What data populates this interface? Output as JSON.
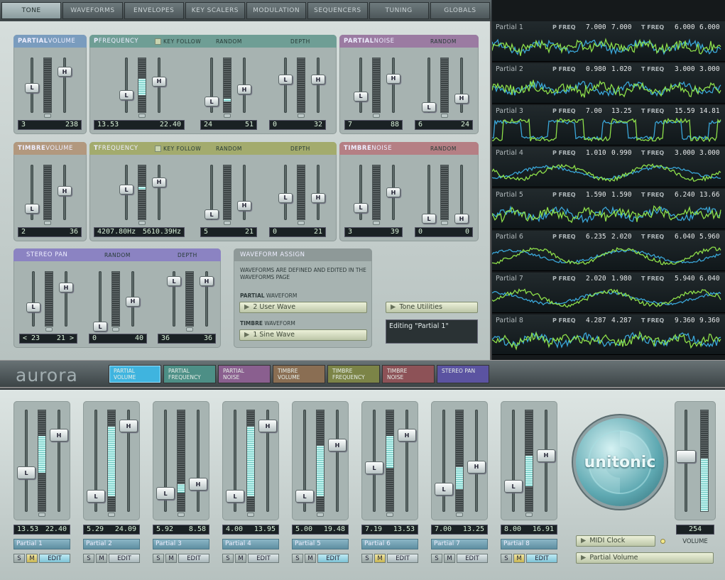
{
  "tabs": [
    "TONE",
    "WAVEFORMS",
    "ENVELOPES",
    "KEY SCALERS",
    "MODULATION",
    "SEQUENCERS",
    "TUNING",
    "GLOBALS"
  ],
  "active_tab": "TONE",
  "panels": {
    "partial_volume": {
      "bold": "PARTIAL",
      "rest": " VOLUME",
      "lo": "3",
      "hi": "238",
      "fill": 0.45
    },
    "p_frequency": {
      "bold": "P",
      "rest": " FREQUENCY",
      "key_follow": "KEY FOLLOW",
      "random": "RANDOM",
      "depth": "DEPTH",
      "lo": "13.53",
      "hi": "22.40",
      "rlo": "24",
      "rhi": "51",
      "dlo": "0",
      "dhi": "32"
    },
    "partial_noise": {
      "bold": "PARTIAL",
      "rest": " NOISE",
      "random": "RANDOM",
      "lo": "7",
      "hi": "88",
      "rlo": "6",
      "rhi": "24"
    },
    "timbre_volume": {
      "bold": "TIMBRE",
      "rest": " VOLUME",
      "lo": "2",
      "hi": "36"
    },
    "t_frequency": {
      "bold": "T",
      "rest": " FREQUENCY",
      "key_follow": "KEY FOLLOW",
      "random": "RANDOM",
      "depth": "DEPTH",
      "lo": "4207.80Hz",
      "hi": "5610.39Hz",
      "rlo": "5",
      "rhi": "21",
      "dlo": "0",
      "dhi": "21"
    },
    "timbre_noise": {
      "bold": "TIMBRE",
      "rest": " NOISE",
      "random": "RANDOM",
      "lo": "3",
      "hi": "39",
      "rlo": "0",
      "rhi": "0"
    },
    "stereo_pan": {
      "title": "STEREO PAN",
      "random": "RANDOM",
      "depth": "DEPTH",
      "lo": "< 23",
      "hi": "21 >",
      "rlo": "0",
      "rhi": "40",
      "dlo": "36",
      "dhi": "36"
    },
    "waveform_assign": {
      "title": "WAVEFORM ASSIGN",
      "note": "WAVEFORMS ARE DEFINED AND EDITED IN THE WAVEFORMS PAGE",
      "pw_bold": "PARTIAL",
      "pw_rest": " WAVEFORM",
      "pw_value": "2  User Wave",
      "tw_bold": "TIMBRE",
      "tw_rest": " WAVEFORM",
      "tw_value": "1  Sine Wave"
    }
  },
  "tone_utilities": "Tone Utilities",
  "editing": "Editing \"Partial 1\"",
  "scope": [
    {
      "name": "Partial 1",
      "pf1": "7.000",
      "pf2": "7.000",
      "tf1": "6.000",
      "tf2": "6.000"
    },
    {
      "name": "Partial 2",
      "pf1": "0.980",
      "pf2": "1.020",
      "tf1": "3.000",
      "tf2": "3.000"
    },
    {
      "name": "Partial 3",
      "pf1": "7.00",
      "pf2": "13.25",
      "tf1": "15.59",
      "tf2": "14.81"
    },
    {
      "name": "Partial 4",
      "pf1": "1.010",
      "pf2": "0.990",
      "tf1": "3.000",
      "tf2": "3.000"
    },
    {
      "name": "Partial 5",
      "pf1": "1.590",
      "pf2": "1.590",
      "tf1": "6.240",
      "tf2": "13.66"
    },
    {
      "name": "Partial 6",
      "pf1": "6.235",
      "pf2": "2.020",
      "tf1": "6.040",
      "tf2": "5.960"
    },
    {
      "name": "Partial 7",
      "pf1": "2.020",
      "pf2": "1.980",
      "tf1": "5.940",
      "tf2": "6.040"
    },
    {
      "name": "Partial 8",
      "pf1": "4.287",
      "pf2": "4.287",
      "tf1": "9.360",
      "tf2": "9.360"
    }
  ],
  "scope_labels": {
    "p": "P FREQ",
    "t": "T FREQ"
  },
  "logo": "aurora",
  "view_tabs": [
    {
      "l1": "PARTIAL",
      "l2": "VOLUME",
      "color": "#3fb4df"
    },
    {
      "l1": "PARTIAL",
      "l2": "FREQUENCY",
      "color": "#4d8f86"
    },
    {
      "l1": "PARTIAL",
      "l2": "NOISE",
      "color": "#8a5f8f"
    },
    {
      "l1": "TIMBRE",
      "l2": "VOLUME",
      "color": "#8a6e53"
    },
    {
      "l1": "TIMBRE",
      "l2": "FREQUENCY",
      "color": "#7c8447"
    },
    {
      "l1": "TIMBRE",
      "l2": "NOISE",
      "color": "#8d5257"
    },
    {
      "l1": "STEREO PAN",
      "l2": "",
      "color": "#5b53a1"
    }
  ],
  "partials": [
    {
      "lo": "13.53",
      "hi": "22.40",
      "name": "Partial 1",
      "m": true,
      "edit": true,
      "fill": [
        0.38,
        0.75
      ]
    },
    {
      "lo": "5.29",
      "hi": "24.09",
      "name": "Partial 2",
      "m": false,
      "edit": false,
      "fill": [
        0.15,
        0.84
      ]
    },
    {
      "lo": "5.92",
      "hi": "8.58",
      "name": "Partial 3",
      "m": false,
      "edit": false,
      "fill": [
        0.18,
        0.27
      ]
    },
    {
      "lo": "4.00",
      "hi": "13.95",
      "name": "Partial 4",
      "m": false,
      "edit": false,
      "fill": [
        0.15,
        0.84
      ]
    },
    {
      "lo": "5.00",
      "hi": "19.48",
      "name": "Partial 5",
      "m": false,
      "edit": true,
      "fill": [
        0.15,
        0.65
      ]
    },
    {
      "lo": "7.19",
      "hi": "13.53",
      "name": "Partial 6",
      "m": true,
      "edit": false,
      "fill": [
        0.43,
        0.75
      ]
    },
    {
      "lo": "7.00",
      "hi": "13.25",
      "name": "Partial 7",
      "m": false,
      "edit": false,
      "fill": [
        0.22,
        0.44
      ]
    },
    {
      "lo": "8.00",
      "hi": "16.91",
      "name": "Partial 8",
      "m": true,
      "edit": true,
      "fill": [
        0.25,
        0.55
      ]
    }
  ],
  "sm": {
    "s": "S",
    "m": "M",
    "edit": "EDIT"
  },
  "brand": "unitonic",
  "midi_clock": "MIDI Clock",
  "bottom_pill": "Partial Volume",
  "master": {
    "value": "254",
    "label": "VOLUME",
    "fill": 0.52
  }
}
